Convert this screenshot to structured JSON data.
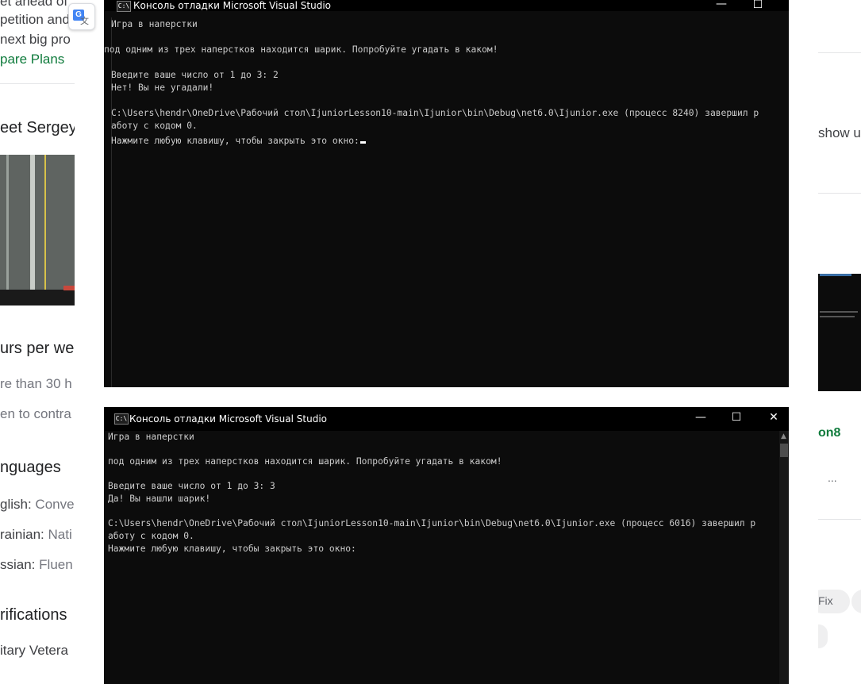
{
  "background_page": {
    "left": {
      "line1": "et ahead of",
      "line2": "petition and",
      "line3": "next big pro",
      "compare_link": "pare Plans",
      "meet_heading": "eet Sergey",
      "hours_heading": "urs per we",
      "hours_text": "re than 30 h",
      "contract_text": "en to contra",
      "languages_heading": "nguages",
      "lang_english_label": "glish:",
      "lang_english_level": "Conve",
      "lang_ukrainian_label": "rainian:",
      "lang_ukrainian_level": "Nati",
      "lang_russian_label": "ssian:",
      "lang_russian_level": "Fluen",
      "verifications_heading": "rifications",
      "military_text": "itary Vetera"
    },
    "right": {
      "show_text": "show u",
      "project_title": "on8",
      "more_dots": "...",
      "tag_text": "Fix"
    }
  },
  "translate_button": {
    "glyph": "G",
    "icon": "google-translate-icon"
  },
  "console_top": {
    "title": "Консоль отладки Microsoft Visual Studio",
    "icon_text": "C:\\",
    "lines": [
      "Игра в наперстки",
      "",
      "под одним из трех наперстков находится шарик. Попробуйте угадать в каком!",
      "",
      "Введите ваше число от 1 до 3: 2",
      "Нет! Вы не угадали!",
      "",
      "C:\\Users\\hendr\\OneDrive\\Рабочий стол\\IjuniorLesson10-main\\Ijunior\\bin\\Debug\\net6.0\\Ijunior.exe (процесс 8240) завершил р",
      "аботу с кодом 0.",
      "Нажмите любую клавишу, чтобы закрыть это окно:"
    ],
    "minimize": "—",
    "maximize": "☐"
  },
  "console_bottom": {
    "title": "Консоль отладки Microsoft Visual Studio",
    "icon_text": "C:\\",
    "lines": [
      "Игра в наперстки",
      "",
      "под одним из трех наперстков находится шарик. Попробуйте угадать в каком!",
      "",
      "Введите ваше число от 1 до 3: 3",
      "Да! Вы нашли шарик!",
      "",
      "C:\\Users\\hendr\\OneDrive\\Рабочий стол\\IjuniorLesson10-main\\Ijunior\\bin\\Debug\\net6.0\\Ijunior.exe (процесс 6016) завершил р",
      "аботу с кодом 0.",
      "Нажмите любую клавишу, чтобы закрыть это окно:"
    ],
    "minimize": "—",
    "maximize": "☐",
    "close": "✕"
  },
  "colors": {
    "console_bg": "#0c0c0c",
    "console_text": "#cccccc",
    "link_green": "#0f7b3c"
  }
}
